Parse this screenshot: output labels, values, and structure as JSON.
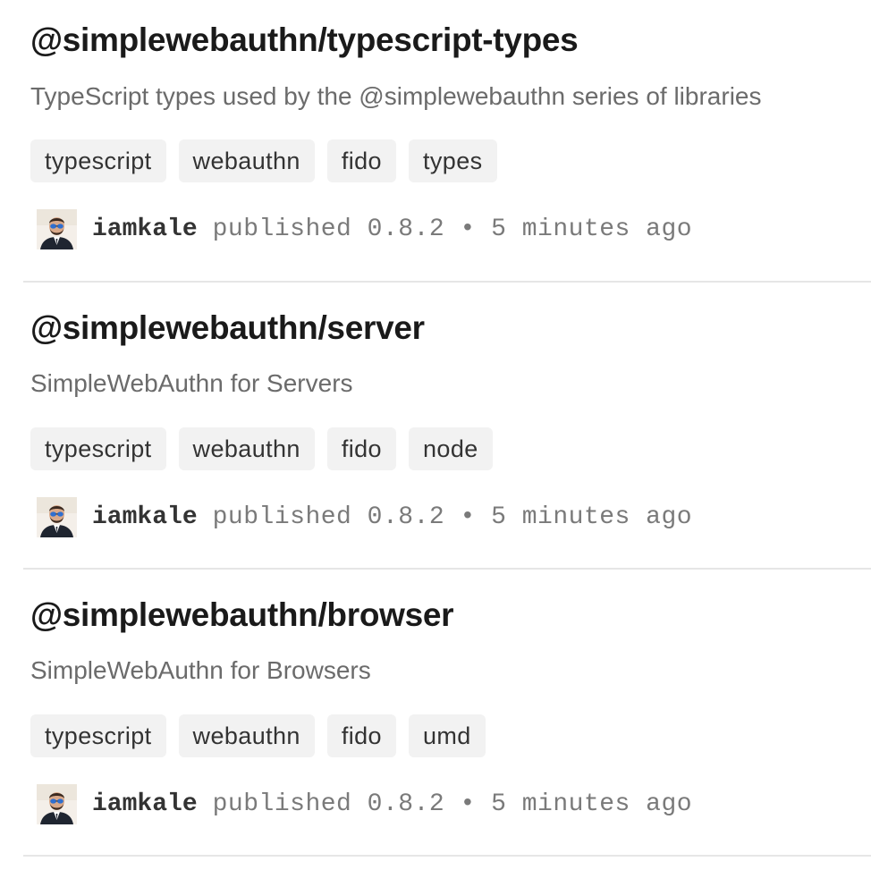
{
  "packages": [
    {
      "name": "@simplewebauthn/typescript-types",
      "description": "TypeScript types used by the @simplewebauthn series of libraries",
      "keywords": [
        "typescript",
        "webauthn",
        "fido",
        "types"
      ],
      "publisher": "iamkale",
      "published_label": "published",
      "version": "0.8.2",
      "separator": "•",
      "time_ago": "5 minutes ago"
    },
    {
      "name": "@simplewebauthn/server",
      "description": "SimpleWebAuthn for Servers",
      "keywords": [
        "typescript",
        "webauthn",
        "fido",
        "node"
      ],
      "publisher": "iamkale",
      "published_label": "published",
      "version": "0.8.2",
      "separator": "•",
      "time_ago": "5 minutes ago"
    },
    {
      "name": "@simplewebauthn/browser",
      "description": "SimpleWebAuthn for Browsers",
      "keywords": [
        "typescript",
        "webauthn",
        "fido",
        "umd"
      ],
      "publisher": "iamkale",
      "published_label": "published",
      "version": "0.8.2",
      "separator": "•",
      "time_ago": "5 minutes ago"
    }
  ],
  "colors": {
    "tag_bg": "#f2f2f2",
    "divider": "#e6e6e6",
    "muted_text": "#6b6b6b"
  }
}
